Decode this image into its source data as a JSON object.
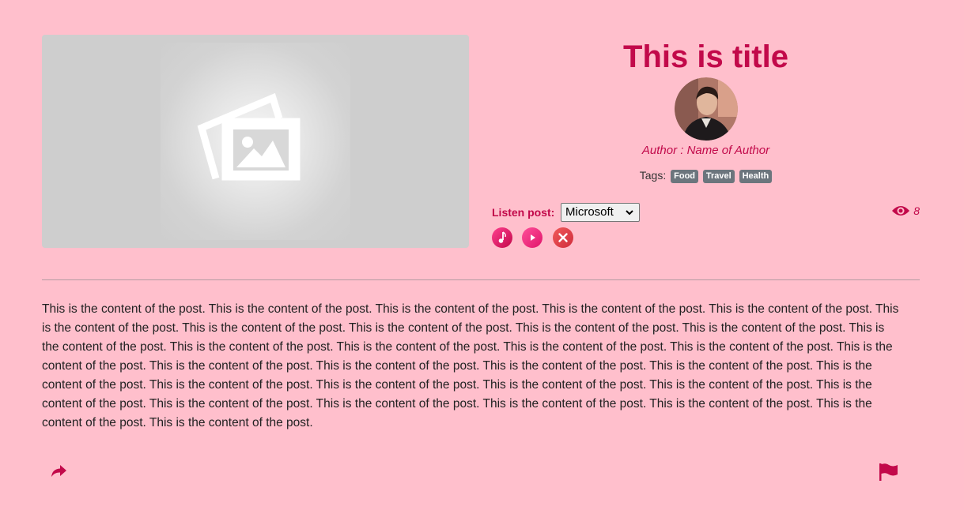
{
  "post": {
    "title": "This is title",
    "author": "Author : Name of Author",
    "tags_label": "Tags:",
    "tags": [
      "Food",
      "Travel",
      "Health"
    ],
    "content": "This is the content of the post. This is the content of the post. This is the content of the post. This is the content of the post. This is the content of the post. This is the content of the post. This is the content of the post. This is the content of the post. This is the content of the post. This is the content of the post. This is the content of the post. This is the content of the post. This is the content of the post. This is the content of the post. This is the content of the post. This is the content of the post. This is the content of the post. This is the content of the post. This is the content of the post. This is the content of the post. This is the content of the post. This is the content of the post. This is the content of the post. This is the content of the post. This is the content of the post. This is the content of the post. This is the content of the post. This is the content of the post. This is the content of the post. This is the content of the post. This is the content of the post. This is the content of the post."
  },
  "listen": {
    "label": "Listen post:",
    "voice_selected": "Microsoft",
    "buttons": [
      "music-icon",
      "play-icon",
      "close-icon"
    ]
  },
  "stats": {
    "views": "8",
    "views_icon": "eye-icon"
  },
  "footer": {
    "share_icon": "share-icon",
    "report_icon": "flag-icon"
  },
  "colors": {
    "background": "#ffbfcc",
    "accent": "#c2094a",
    "tag_bg": "#6c757d"
  }
}
